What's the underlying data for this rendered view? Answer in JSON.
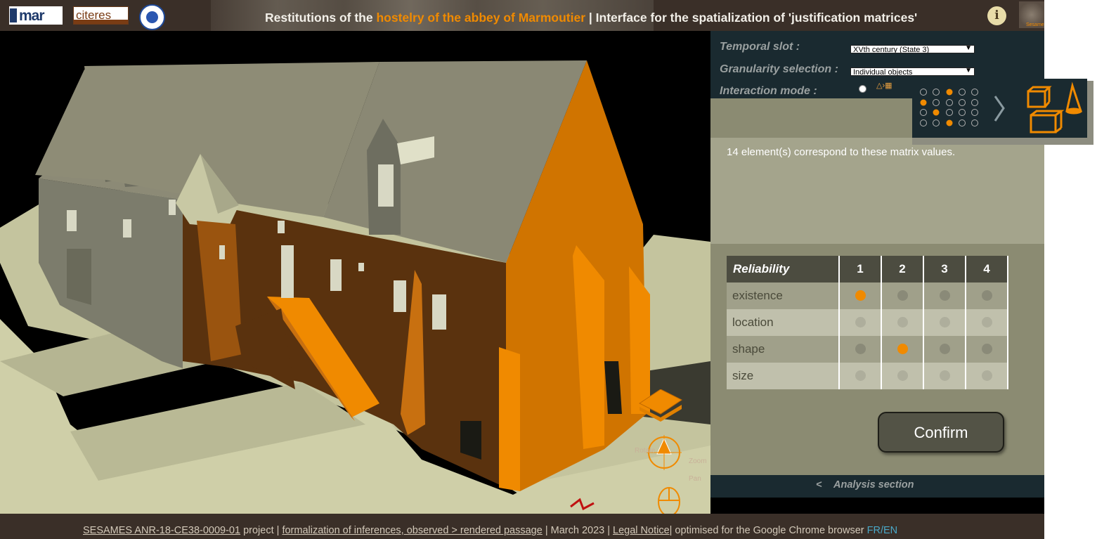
{
  "header": {
    "logos": {
      "mar_text": "mar",
      "citeres_text": "citeres"
    },
    "title": {
      "prefix": "Restitutions of the ",
      "highlight": "hostelry of the abbey of Marmoutier",
      "suffix": " | Interface for the spatialization of 'justification matrices'"
    },
    "info_label": "i",
    "sesame_label": "Sesame"
  },
  "viewer": {
    "controls": {
      "rotate": "Rotate",
      "zoom": "Zoom",
      "pan": "Pan"
    }
  },
  "panel": {
    "temporal_label": "Temporal slot :",
    "temporal_value": "XVth century (State 3)",
    "granularity_label": "Granularity selection :",
    "granularity_value": "Individual objects",
    "interaction_label": "Interaction mode :",
    "result_text": "14 element(s) correspond to these matrix values.",
    "matrix": {
      "header": "Reliability",
      "columns": [
        "1",
        "2",
        "3",
        "4"
      ],
      "rows": [
        {
          "label": "existence",
          "selected": 1
        },
        {
          "label": "location",
          "selected": 1
        },
        {
          "label": "shape",
          "selected": 2
        },
        {
          "label": "size",
          "selected": 2
        }
      ]
    },
    "confirm_label": "Confirm",
    "analysis_arrow": "<",
    "analysis_label": "Analysis section"
  },
  "footer": {
    "project_link": "SESAMES ANR-18-CE38-0009-01",
    "project_suffix": " project | ",
    "formalization_link": "formalization of inferences, observed > rendered passage",
    "date": " | March 2023 | ",
    "legal_link": "Legal Notice",
    "browser_note": "| optimised for the Google Chrome browser ",
    "lang": "FR/EN"
  },
  "colors": {
    "accent": "#f08a00",
    "panel": "#8b8b72",
    "dark": "#1a2a30"
  }
}
